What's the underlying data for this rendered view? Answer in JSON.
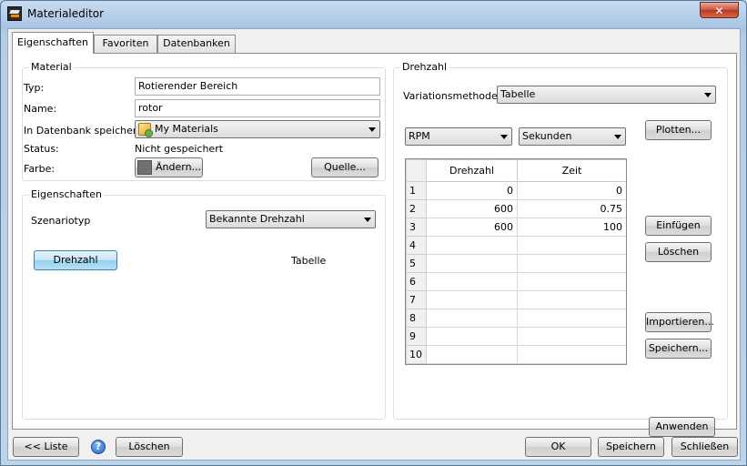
{
  "window": {
    "title": "Materialeditor",
    "close_glyph": "✕",
    "icon": "materialeditor-app-icon"
  },
  "tabs": [
    {
      "label": "Eigenschaften",
      "active": true
    },
    {
      "label": "Favoriten",
      "active": false
    },
    {
      "label": "Datenbanken",
      "active": false
    }
  ],
  "material": {
    "group_title": "Material",
    "type_label": "Typ:",
    "type_value": "Rotierender Bereich",
    "name_label": "Name:",
    "name_value": "rotor",
    "db_label": "In Datenbank speichern:",
    "db_value": "My Materials",
    "status_label": "Status:",
    "status_value": "Nicht gespeichert",
    "color_label": "Farbe:",
    "color_button": "Ändern...",
    "color_swatch": "#707070",
    "source_button": "Quelle..."
  },
  "properties": {
    "group_title": "Eigenschaften",
    "scenario_label": "Szenariotyp",
    "scenario_value": "Bekannte Drehzahl",
    "speed_button": "Drehzahl",
    "speed_value": "Tabelle"
  },
  "speed": {
    "group_title": "Drehzahl",
    "variation_label": "Variationsmethode:",
    "variation_value": "Tabelle",
    "unit_value": "RPM",
    "time_unit_value": "Sekunden",
    "plot_button": "Plotten...",
    "insert_button": "Einfügen",
    "delete_button": "Löschen",
    "import_button": "Importieren...",
    "save_button": "Speichern...",
    "apply_button": "Anwenden",
    "table": {
      "columns": [
        "Drehzahl",
        "Zeit"
      ],
      "rows": [
        {
          "num": "1",
          "speed": "0",
          "time": "0"
        },
        {
          "num": "2",
          "speed": "600",
          "time": "0.75"
        },
        {
          "num": "3",
          "speed": "600",
          "time": "100"
        },
        {
          "num": "4",
          "speed": "",
          "time": ""
        },
        {
          "num": "5",
          "speed": "",
          "time": ""
        },
        {
          "num": "6",
          "speed": "",
          "time": ""
        },
        {
          "num": "7",
          "speed": "",
          "time": ""
        },
        {
          "num": "8",
          "speed": "",
          "time": ""
        },
        {
          "num": "9",
          "speed": "",
          "time": ""
        },
        {
          "num": "10",
          "speed": "",
          "time": ""
        }
      ]
    }
  },
  "footer": {
    "list_button": "<< Liste",
    "help_glyph": "?",
    "delete_button": "Löschen",
    "ok_button": "OK",
    "save_button": "Speichern",
    "close_button": "Schließen"
  }
}
